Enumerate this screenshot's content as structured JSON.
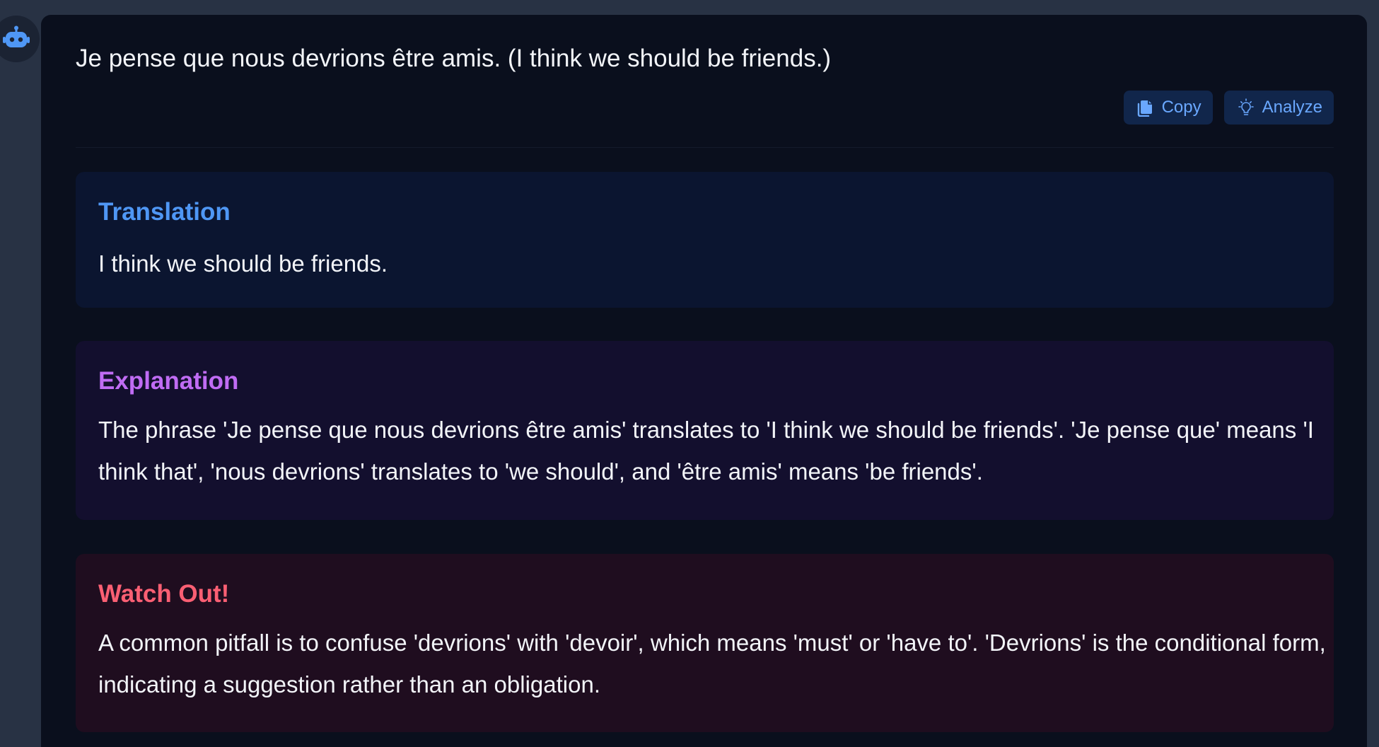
{
  "message": {
    "text": "Je pense que nous devrions être amis. (I think we should be friends.)"
  },
  "actions": {
    "copy_label": "Copy",
    "analyze_label": "Analyze"
  },
  "sections": {
    "translation": {
      "title": "Translation",
      "body": "I think we should be friends."
    },
    "explanation": {
      "title": "Explanation",
      "body": "The phrase 'Je pense que nous devrions être amis' translates to 'I think we should be friends'. 'Je pense que' means 'I think that', 'nous devrions' translates to 'we should', and 'être amis' means 'be friends'."
    },
    "watch_out": {
      "title": "Watch Out!",
      "body": "A common pitfall is to confuse 'devrions' with 'devoir', which means 'must' or 'have to'. 'Devrions' is the conditional form, indicating a suggestion rather than an obligation."
    }
  },
  "icons": {
    "avatar": "robot-icon",
    "copy": "copy-icon",
    "analyze": "lightbulb-icon"
  },
  "colors": {
    "accent_blue": "#4f97f5",
    "accent_purple": "#c06cf4",
    "accent_red": "#fa5f73"
  }
}
